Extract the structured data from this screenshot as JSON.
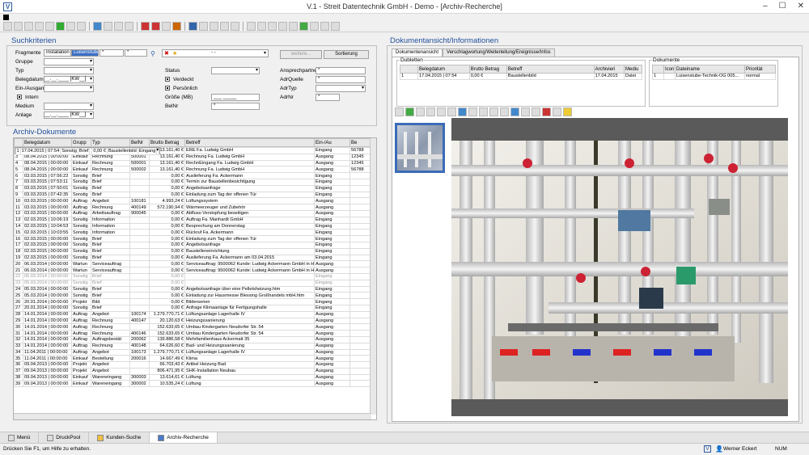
{
  "window": {
    "title": "V.1 - Streit Datentechnik GmbH - Demo - [Archiv-Recherche]",
    "min": "–",
    "max": "☐",
    "close": "✕"
  },
  "search": {
    "title": "Suchkriterien",
    "fragmente_label": "Fragmente",
    "fragment1": "Installation",
    "fragment2": "Luisenstube",
    "fragment3": "*",
    "fragment4": "*",
    "gruppe": "Gruppe",
    "typ": "Typ",
    "belegdatum": "Belegdatum",
    "belegdatum_value": "__.__.____ [KW__]",
    "ein_ausgang": "Ein-/Ausgang",
    "intern": "Intern",
    "medium": "Medium",
    "anlage": "Anlage",
    "anlage_value": "__.__.____ [KW__]",
    "status": "Status",
    "verdeckt": "Verdeckt",
    "persoenlich": "Persönlich",
    "groesse": "Größe (MB)",
    "groesse_value": "___  _____",
    "belnr": "BelNr",
    "belnr_value": "*",
    "fav_select": "- -",
    "weitere_btn": "weitere...",
    "sortierung_btn": "Sortierung",
    "ansprechpartner": "Ansprechpartner",
    "ansprechpartner_value": "*",
    "adrquelle": "AdrQuelle",
    "adrquelle_value": "*",
    "adrtyp": "AdrTyp",
    "adrnr": "AdrNr",
    "adrnr_value": "*"
  },
  "archive": {
    "title": "Archiv-Dokumente",
    "columns": [
      "",
      "Belegdatum",
      "Grupp",
      "Typ",
      "BelNr",
      "Brutto Betrag",
      "Betreff",
      "Ein-/Au",
      "Be"
    ],
    "rows": [
      [
        "1",
        "17.04.2015 | 07:54",
        "Sonstig",
        "Brief",
        "",
        "0,00 €",
        "Baustellenbild",
        "Eingang",
        ""
      ],
      [
        "2",
        "08.04.2015 | 16:58:00",
        "Einkauf",
        "Rechnung",
        "",
        "13.161,40 €",
        "ERE Fa. Ludwig GmbH",
        "Eingang",
        "56788"
      ],
      [
        "3",
        "08.04.2015 | 00:00:00",
        "Einkauf",
        "Rechnung",
        "500001",
        "13.161,40 €",
        "Rechnung Fa. Ludwig GmbH",
        "Ausgang",
        "12345"
      ],
      [
        "4",
        "08.04.2015 | 00:00:00",
        "Einkauf",
        "Rechnung",
        "500001",
        "13.161,40 €",
        "RechnEingang Fa. Ludwig GmbH",
        "Ausgang",
        "12345"
      ],
      [
        "5",
        "08.04.2015 | 00:00:00",
        "Einkauf",
        "Rechnung",
        "500002",
        "13.161,40 €",
        "Rechnung Fa. Ludwig GmbH",
        "Ausgang",
        "56788"
      ],
      [
        "6",
        "03.03.2015 | 07:56:22",
        "Sonstig",
        "Brief",
        "",
        "0,00 €",
        "Auslieferung Fa. Ackermann",
        "Eingang",
        ""
      ],
      [
        "7",
        "03.03.2015 | 07:53:11",
        "Sonstig",
        "Brief",
        "",
        "0,00 €",
        "Termin zur Baustellenbesichtigung",
        "Eingang",
        ""
      ],
      [
        "8",
        "03.03.2015 | 07:50:01",
        "Sonstig",
        "Brief",
        "",
        "0,00 €",
        "Angebotsanfrage",
        "Eingang",
        ""
      ],
      [
        "9",
        "03.03.2015 | 07:42:35",
        "Sonstig",
        "Brief",
        "",
        "0,00 €",
        "Einladung zum Tag der offenen Tür",
        "Eingang",
        ""
      ],
      [
        "10",
        "03.03.2015 | 00:00:00",
        "Auftrag",
        "Angebot",
        "100181",
        "4.993,24 €",
        "Lüftungssystem",
        "Ausgang",
        ""
      ],
      [
        "11",
        "03.03.2015 | 00:00:00",
        "Auftrag",
        "Rechnung",
        "400149",
        "572.190,94 €",
        "Wärmeerzeuger und Zubehör",
        "Ausgang",
        ""
      ],
      [
        "12",
        "03.03.2015 | 00:00:00",
        "Auftrag",
        "Arbeitsauftrag",
        "900045",
        "0,00 €",
        "Abfluss-Verstopfung beseitigen",
        "Ausgang",
        ""
      ],
      [
        "13",
        "02.03.2015 | 10:06:19",
        "Sonstig",
        "Information",
        "",
        "0,00 €",
        "Auftrag Fa. Manhardt GmbH",
        "Eingang",
        ""
      ],
      [
        "14",
        "02.03.2015 | 10:04:53",
        "Sonstig",
        "Information",
        "",
        "0,00 €",
        "Besprechung am Donnerstag",
        "Eingang",
        ""
      ],
      [
        "15",
        "02.03.2015 | 10:03:55",
        "Sonstig",
        "Information",
        "",
        "0,00 €",
        "Rückruf Fa. Ackermann",
        "Eingang",
        ""
      ],
      [
        "16",
        "02.03.2015 | 00:00:00",
        "Sonstig",
        "Brief",
        "",
        "0,00 €",
        "Einladung zum Tag der offenen Tür",
        "Eingang",
        ""
      ],
      [
        "17",
        "02.03.2015 | 00:00:00",
        "Sonstig",
        "Brief",
        "",
        "0,00 €",
        "Angebotsanfrage",
        "Eingang",
        ""
      ],
      [
        "18",
        "02.03.2015 | 00:00:00",
        "Sonstig",
        "Brief",
        "",
        "0,00 €",
        "Baustelleneinrichtung",
        "Eingang",
        ""
      ],
      [
        "19",
        "02.03.2015 | 00:00:00",
        "Sonstig",
        "Brief",
        "",
        "0,00 €",
        "Auslieferung Fa. Ackermann am 03.04.2015",
        "Eingang",
        ""
      ],
      [
        "20",
        "06.03.2014 | 00:00:00",
        "Wartun",
        "Serviceauftrag",
        "",
        "0,00 €",
        "Serviceauftrag: 9500062  Kunde: Ludwig Ackermann GmbH in Ha",
        "Ausgang",
        ""
      ],
      [
        "21",
        "06.03.2014 | 00:00:00",
        "Wartun",
        "Serviceauftrag",
        "",
        "0,00 €",
        "Serviceauftrag: 9500062  Kunde: Ludwig Ackermann GmbH in Ha",
        "Ausgang",
        ""
      ],
      [
        "22",
        "05.03.2014 | 00:00:00",
        "Sonstig",
        "Brief",
        "",
        "0,00 €",
        "",
        "Eingang",
        ""
      ],
      [
        "23",
        "05.03.2014 | 00:00:00",
        "Sonstig",
        "Brief",
        "",
        "0,00 €",
        "",
        "Eingang",
        ""
      ],
      [
        "24",
        "05.03.2014 | 00:00:00",
        "Sonstig",
        "Brief",
        "",
        "0,00 €",
        "Angebotsanfrage über eine Pelletsheizung.htm",
        "Eingang",
        ""
      ],
      [
        "25",
        "05.03.2014 | 00:00:00",
        "Sonstig",
        "Brief",
        "",
        "0,00 €",
        "Einladung zur Hausmesse   Blessing Großhandels mbH.htm",
        "Eingang",
        ""
      ],
      [
        "26",
        "20.01.2014 | 00:00:00",
        "Projekt",
        "Bild",
        "",
        "0,00 €",
        "Bilderserien",
        "Eingang",
        ""
      ],
      [
        "27",
        "20.01.2014 | 00:00:00",
        "Sonstig",
        "Brief",
        "",
        "0,00 €",
        "Anfrage Klimaanlage für Fertigungshalle",
        "Eingang",
        ""
      ],
      [
        "28",
        "14.01.2014 | 00:00:00",
        "Auftrag",
        "Angebot",
        "100174",
        "1.279.770,71 €",
        "Lüftungsanlage Lagerhalle IV",
        "Ausgang",
        ""
      ],
      [
        "29",
        "14.01.2014 | 00:00:00",
        "Auftrag",
        "Rechnung",
        "400147",
        "20.120,63 €",
        "Heizungssanierung",
        "Ausgang",
        ""
      ],
      [
        "30",
        "14.01.2014 | 00:00:00",
        "Auftrag",
        "Rechnung",
        "",
        "152.633,65 €",
        "Umbau Kindergarten Neudorfer Str. 54",
        "Ausgang",
        ""
      ],
      [
        "31",
        "14.01.2014 | 00:00:00",
        "Auftrag",
        "Rechnung",
        "400146",
        "152.633,65 €",
        "Umbau Kindergarten Neudorfer Str. 54",
        "Ausgang",
        ""
      ],
      [
        "32",
        "14.01.2014 | 00:00:00",
        "Auftrag",
        "Auftragsbestät",
        "200062",
        "139.886,58 €",
        "Mehrfamilienhaus Ackermatt 35",
        "Ausgang",
        ""
      ],
      [
        "33",
        "14.01.2014 | 00:00:00",
        "Auftrag",
        "Rechnung",
        "400148",
        "64.626,60 €",
        "Bad- und Heizungssanierung",
        "Ausgang",
        ""
      ],
      [
        "34",
        "11.04.2011 | 00:00:00",
        "Auftrag",
        "Angebot",
        "100173",
        "1.279.770,71 €",
        "Lüftungsanlage Lagerhalle IV",
        "Ausgang",
        ""
      ],
      [
        "35",
        "11.04.2011 | 00:00:00",
        "Einkauf",
        "Bestellung",
        "200016",
        "14.667,49 €",
        "Klima",
        "Ausgang",
        ""
      ],
      [
        "36",
        "09.04.2013 | 00:00:00",
        "Projekt",
        "Angebot",
        "",
        "66.703,43 €",
        "Artikel Heizung Bad",
        "Ausgang",
        ""
      ],
      [
        "37",
        "09.04.2013 | 00:00:00",
        "Projekt",
        "Angebot",
        "",
        "806.471,95 €",
        "SHK-Installation Neubau",
        "Ausgang",
        ""
      ],
      [
        "38",
        "09.04.2013 | 00:00:00",
        "Einkauf",
        "Wareneingang",
        "300003",
        "13.614,61 €",
        "Lüftung",
        "Ausgang",
        ""
      ],
      [
        "39",
        "09.04.2013 | 00:00:00",
        "Einkauf",
        "Wareneingang",
        "300002",
        "10.535,24 €",
        "Lüftung",
        "Ausgang",
        ""
      ]
    ]
  },
  "docview": {
    "title": "Dokumentansicht/Informationen",
    "tabs": [
      "Dokumentenansicht",
      "Verschlagwortung/Weiterleitung/Ereignisse/Infos"
    ],
    "dubletten": "Dubletten",
    "dub_columns": [
      "",
      "Belegdatum",
      "Brutto Betrag",
      "Betreff",
      "Archivieri",
      "Mediu"
    ],
    "dub_row": [
      "1",
      "17.04.2015 | 07:54",
      "0,00 €",
      "Baustellenbild",
      "17.04.2015",
      "Datei"
    ],
    "dokumente": "Dokumente",
    "doc_columns": [
      "",
      "Icon",
      "Dateiname",
      "Priorität"
    ],
    "doc_row": [
      "1",
      "",
      "Luisenstube-Technik-OG 005...",
      "normal"
    ]
  },
  "bottom_tabs": [
    "Menü",
    "DruckPool",
    "Kunden-Suche",
    "Archiv-Recherche"
  ],
  "status": {
    "help": "Drücken Sie F1, um Hilfe zu erhalten.",
    "user": "Werner Eckert",
    "num": "NUM"
  }
}
